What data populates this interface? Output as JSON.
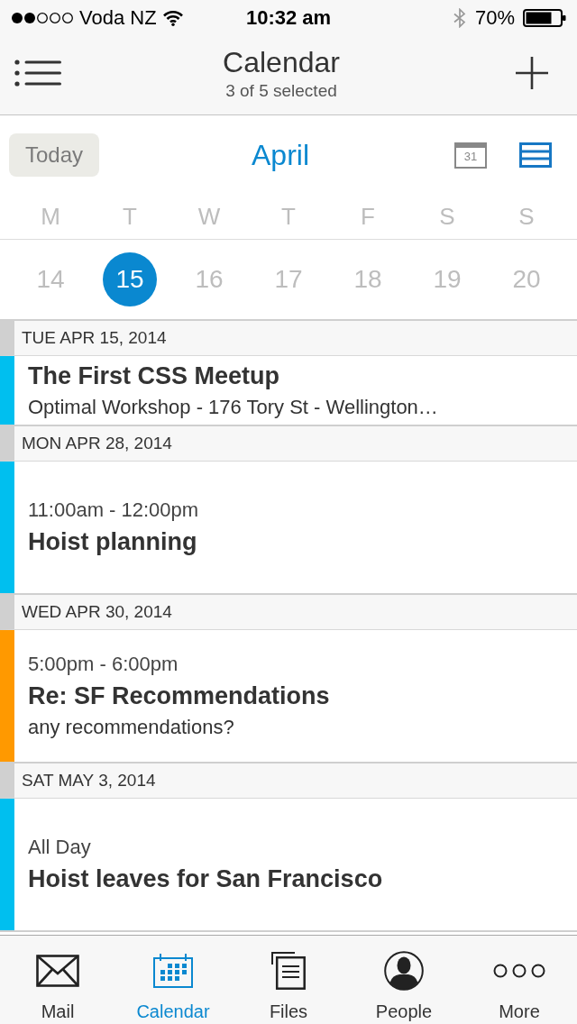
{
  "status_bar": {
    "carrier": "Voda NZ",
    "time": "10:32 am",
    "battery": "70%"
  },
  "nav_bar": {
    "title": "Calendar",
    "subtitle": "3 of 5 selected"
  },
  "toolbar": {
    "today_button": "Today",
    "month": "April",
    "view_toggles": [
      {
        "kind": "day",
        "label": "31",
        "selected": false
      },
      {
        "kind": "list",
        "selected": true
      }
    ]
  },
  "week": {
    "weekdays": [
      "M",
      "T",
      "W",
      "T",
      "F",
      "S",
      "S"
    ],
    "dates": [
      {
        "label": "14",
        "selected": false
      },
      {
        "label": "15",
        "selected": true
      },
      {
        "label": "16",
        "selected": false
      },
      {
        "label": "17",
        "selected": false
      },
      {
        "label": "18",
        "selected": false
      },
      {
        "label": "19",
        "selected": false
      },
      {
        "label": "20",
        "selected": false
      }
    ]
  },
  "agenda": [
    {
      "date": "TUE APR 15, 2014",
      "events": [
        {
          "title": "The First CSS Meetup",
          "details": "Optimal Workshop - 176 Tory St - Wellington…",
          "color": "#00bfef"
        }
      ]
    },
    {
      "date": "MON APR 28, 2014",
      "events": [
        {
          "time": "11:00am - 12:00pm",
          "title": "Hoist planning",
          "color": "#00bfef"
        }
      ]
    },
    {
      "date": "WED APR 30, 2014",
      "events": [
        {
          "time": "5:00pm - 6:00pm",
          "title": "Re: SF Recommendations",
          "details": "any recommendations?",
          "color": "#ff9900"
        }
      ]
    },
    {
      "date": "SAT MAY 3, 2014",
      "events": [
        {
          "time": "All Day",
          "title": "Hoist leaves for San Francisco",
          "color": "#00bfef"
        }
      ]
    }
  ],
  "tabs": [
    {
      "kind": "mail",
      "label": "Mail",
      "selected": false
    },
    {
      "kind": "calendar",
      "label": "Calendar",
      "selected": true
    },
    {
      "kind": "files",
      "label": "Files",
      "selected": false
    },
    {
      "kind": "people",
      "label": "People",
      "selected": false
    },
    {
      "kind": "more",
      "label": "More",
      "selected": false
    }
  ]
}
